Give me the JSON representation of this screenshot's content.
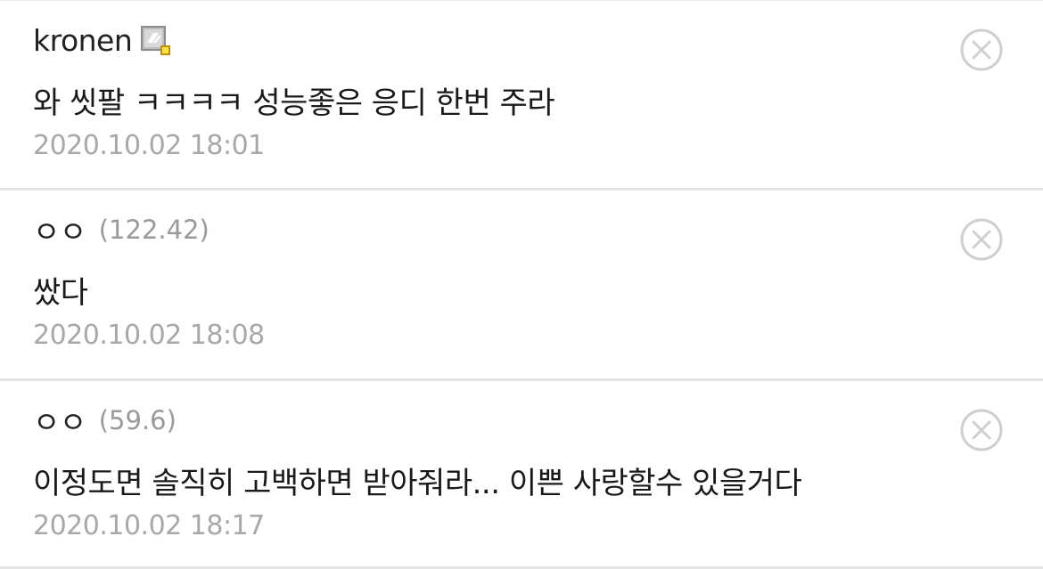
{
  "comments": [
    {
      "nickname": "kronen",
      "has_gallog_icon": true,
      "ip": "",
      "text": "와 씻팔 ㅋㅋㅋㅋ 성능좋은 응디 한번 주라",
      "timestamp": "2020.10.02 18:01",
      "delete_icon": "close-circle-icon"
    },
    {
      "nickname": "ㅇㅇ",
      "has_gallog_icon": false,
      "ip": "(122.42)",
      "text": "쌌다",
      "timestamp": "2020.10.02 18:08",
      "delete_icon": "close-circle-icon"
    },
    {
      "nickname": "ㅇㅇ",
      "has_gallog_icon": false,
      "ip": "(59.6)",
      "text": "이정도면 솔직히 고백하면 받아줘라... 이쁜 사랑할수 있을거다",
      "timestamp": "2020.10.02 18:17",
      "delete_icon": "close-circle-icon"
    }
  ],
  "colors": {
    "text": "#1a1a1a",
    "meta": "#a8a8a8",
    "divider": "#e3e3e6",
    "icon": "#cfcfcf"
  }
}
